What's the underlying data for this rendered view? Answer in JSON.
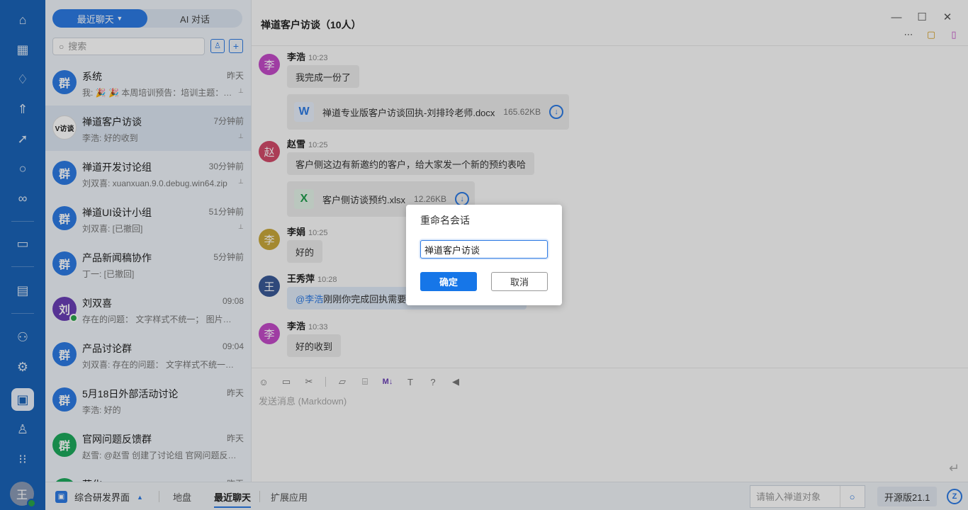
{
  "rail": {
    "items": [
      "home-icon",
      "apps-icon",
      "lightbulb-icon",
      "rocket-icon",
      "plane-icon",
      "search-icon",
      "infinity-icon",
      "chart-board-icon",
      "document-icon",
      "contacts-icon",
      "settings-icon",
      "chat-icon",
      "user-icon",
      "grid-icon"
    ],
    "avatar_char": "王"
  },
  "sidebar": {
    "tab_recent": "最近聊天",
    "tab_ai": "AI 对话",
    "search_placeholder": "搜索",
    "conversations": [
      {
        "name": "系统",
        "time": "昨天",
        "preview": "我: 🎉 🎉 本周培训预告：培训主题：…",
        "avatar": "群",
        "color": "#2d7ae3",
        "pinned": true
      },
      {
        "name": "禅道客户访谈",
        "time": "7分钟前",
        "preview": "李浩: 好的收到",
        "avatar": "V访谈",
        "color": "#ffffff",
        "pinned": true
      },
      {
        "name": "禅道开发讨论组",
        "time": "30分钟前",
        "preview": "刘双喜: xuanxuan.9.0.debug.win64.zip",
        "avatar": "群",
        "color": "#2d7ae3",
        "pinned": true
      },
      {
        "name": "禅道UI设计小组",
        "time": "51分钟前",
        "preview": "刘双喜: [已撤回]",
        "avatar": "群",
        "color": "#2d7ae3",
        "pinned": true
      },
      {
        "name": "产品新闻稿协作",
        "time": "5分钟前",
        "preview": "丁一: [已撤回]",
        "avatar": "群",
        "color": "#2d7ae3",
        "pinned": false
      },
      {
        "name": "刘双喜",
        "time": "09:08",
        "preview": "存在的问题： 文字样式不统一； 图片大…",
        "avatar": "刘",
        "color": "#6a3fb5",
        "pinned": false
      },
      {
        "name": "产品讨论群",
        "time": "09:04",
        "preview": "刘双喜: 存在的问题： 文字样式不统一：…",
        "avatar": "群",
        "color": "#2d7ae3",
        "pinned": false
      },
      {
        "name": "5月18日外部活动讨论",
        "time": "昨天",
        "preview": "李浩: 好的",
        "avatar": "群",
        "color": "#2d7ae3",
        "pinned": false
      },
      {
        "name": "官网问题反馈群",
        "time": "昨天",
        "preview": "赵雪: @赵雪 创建了讨论组 官网问题反…",
        "avatar": "群",
        "color": "#1da95c",
        "pinned": false
      },
      {
        "name": "菲化",
        "time": "昨天",
        "preview": "",
        "avatar": "群",
        "color": "#1da95c",
        "pinned": false
      }
    ]
  },
  "chat": {
    "title": "禅道客户访谈（10人）",
    "messages": [
      {
        "sender": "李浩",
        "time": "10:23",
        "avatar": "李",
        "color": "#c24bc7"
      },
      {
        "sender": "赵雪",
        "time": "10:25",
        "avatar": "赵",
        "color": "#d14b6a"
      },
      {
        "sender": "李娟",
        "time": "10:25",
        "avatar": "李",
        "color": "#c9a83a"
      },
      {
        "sender": "王秀萍",
        "time": "10:28",
        "avatar": "王",
        "color": "#3a5a96"
      },
      {
        "sender": "李浩",
        "time": "10:33",
        "avatar": "李",
        "color": "#c24bc7"
      }
    ],
    "texts": {
      "m1": "我完成一份了",
      "m2": "客户侧这边有新邀约的客户，给大家发一个新的预约表哈",
      "m3": "好的",
      "m4_mention": "@李浩",
      "m4_text": " 刚刚你完成回执需要",
      "m5": "好的收到"
    },
    "files": [
      {
        "name": "禅道专业版客户访谈回执-刘排玲老师.docx",
        "size": "165.62KB",
        "type": "W",
        "color": "#2d7ae3"
      },
      {
        "name": "客户侧访谈预约.xlsx",
        "size": "12.26KB",
        "type": "X",
        "color": "#1f9d4c"
      }
    ],
    "composer_placeholder": "发送消息 (Markdown)",
    "toolbar": [
      "emoji-icon",
      "image-icon",
      "scissors-icon",
      "folder-icon",
      "code-icon",
      "markdown-icon",
      "text-format-icon",
      "help-icon",
      "megaphone-icon"
    ]
  },
  "dialog": {
    "title": "重命名会话",
    "value": "禅道客户访谈",
    "ok": "确定",
    "cancel": "取消"
  },
  "bottom": {
    "workspace": "综合研发界面",
    "tabs": [
      "地盘",
      "最近聊天",
      "扩展应用"
    ],
    "search_placeholder": "请输入禅道对象",
    "version": "开源版21.1"
  }
}
